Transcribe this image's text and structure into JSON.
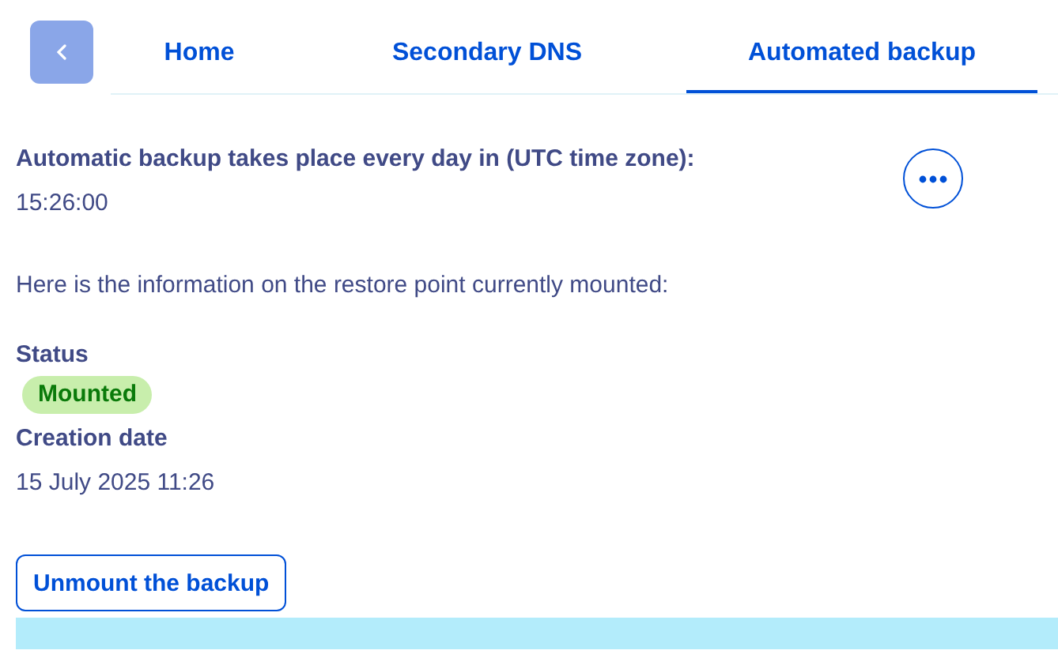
{
  "tabs": [
    {
      "label": "Home",
      "selected": false
    },
    {
      "label": "Secondary DNS",
      "selected": false
    },
    {
      "label": "Automated backup",
      "selected": true
    }
  ],
  "schedule": {
    "label": "Automatic backup takes place every day in (UTC time zone):",
    "value": "15:26:00"
  },
  "intro": "Here is the information on the restore point currently mounted:",
  "status": {
    "label": "Status",
    "badge": "Mounted"
  },
  "creation_date": {
    "label": "Creation date",
    "value": "15 July 2025 11:26"
  },
  "unmount_button": "Unmount the backup"
}
